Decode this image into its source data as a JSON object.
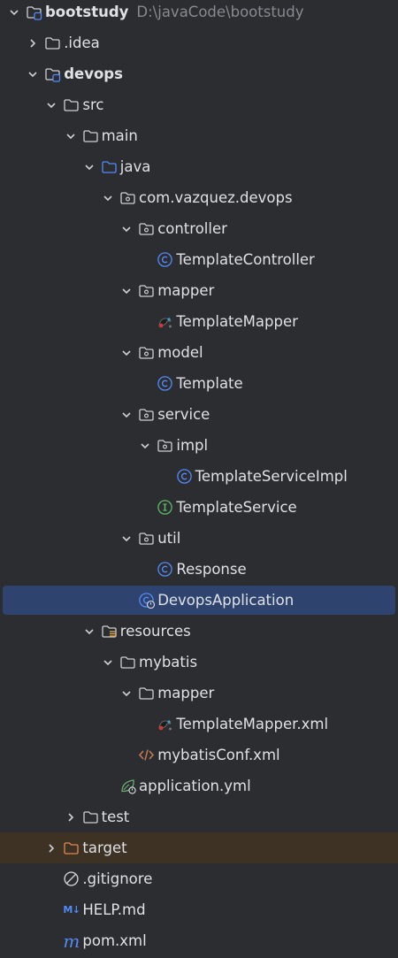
{
  "project": {
    "root_label": "bootstudy",
    "root_path": "D:\\javaCode\\bootstudy",
    "nodes": [
      {
        "label": "bootstudy",
        "hint": "D:\\javaCode\\bootstudy",
        "icon": "module-folder-icon",
        "expanded": true,
        "depth": 0
      },
      {
        "label": ".idea",
        "icon": "folder-icon",
        "expanded": false,
        "depth": 1
      },
      {
        "label": "devops",
        "icon": "module-folder-icon",
        "expanded": true,
        "depth": 1
      },
      {
        "label": "src",
        "icon": "folder-icon",
        "expanded": true,
        "depth": 2
      },
      {
        "label": "main",
        "icon": "folder-icon",
        "expanded": true,
        "depth": 3
      },
      {
        "label": "java",
        "icon": "source-root-folder-icon",
        "expanded": true,
        "depth": 4
      },
      {
        "label": "com.vazquez.devops",
        "icon": "package-icon",
        "expanded": true,
        "depth": 5
      },
      {
        "label": "controller",
        "icon": "package-icon",
        "expanded": true,
        "depth": 6
      },
      {
        "label": "TemplateController",
        "icon": "class-icon",
        "depth": 7
      },
      {
        "label": "mapper",
        "icon": "package-icon",
        "expanded": true,
        "depth": 6
      },
      {
        "label": "TemplateMapper",
        "icon": "mybatis-icon",
        "depth": 7
      },
      {
        "label": "model",
        "icon": "package-icon",
        "expanded": true,
        "depth": 6
      },
      {
        "label": "Template",
        "icon": "class-icon",
        "depth": 7
      },
      {
        "label": "service",
        "icon": "package-icon",
        "expanded": true,
        "depth": 6
      },
      {
        "label": "impl",
        "icon": "package-icon",
        "expanded": true,
        "depth": 7
      },
      {
        "label": "TemplateServiceImpl",
        "icon": "class-icon",
        "depth": 8
      },
      {
        "label": "TemplateService",
        "icon": "interface-icon",
        "depth": 7
      },
      {
        "label": "util",
        "icon": "package-icon",
        "expanded": true,
        "depth": 6
      },
      {
        "label": "Response",
        "icon": "class-icon",
        "depth": 7
      },
      {
        "label": "DevopsApplication",
        "icon": "spring-boot-class-icon",
        "depth": 6,
        "selected": true
      },
      {
        "label": "resources",
        "icon": "resources-folder-icon",
        "expanded": true,
        "depth": 4
      },
      {
        "label": "mybatis",
        "icon": "folder-icon",
        "expanded": true,
        "depth": 5
      },
      {
        "label": "mapper",
        "icon": "folder-icon",
        "expanded": true,
        "depth": 6
      },
      {
        "label": "TemplateMapper.xml",
        "icon": "mybatis-icon",
        "depth": 7
      },
      {
        "label": "mybatisConf.xml",
        "icon": "xml-icon",
        "depth": 6
      },
      {
        "label": "application.yml",
        "icon": "spring-yaml-icon",
        "depth": 5
      },
      {
        "label": "test",
        "icon": "folder-icon",
        "expanded": false,
        "depth": 3
      },
      {
        "label": "target",
        "icon": "excluded-folder-icon",
        "expanded": false,
        "depth": 2,
        "excluded": true
      },
      {
        "label": ".gitignore",
        "icon": "gitignore-icon",
        "depth": 2
      },
      {
        "label": "HELP.md",
        "icon": "markdown-icon",
        "depth": 2
      },
      {
        "label": "pom.xml",
        "icon": "maven-icon",
        "depth": 2
      }
    ]
  },
  "icon_text": {
    "markdown": "M↓",
    "maven": "m"
  },
  "colors": {
    "background": "#2b2d30",
    "text": "#dfe1e5",
    "hint": "#868a91",
    "selection": "#2e436e",
    "excluded_row": "#3d3223",
    "class_blue": "#548af7",
    "interface_green": "#5fb865",
    "xml_orange": "#c77d55",
    "excluded_orange": "#e08855",
    "spring_green": "#6aab73"
  }
}
